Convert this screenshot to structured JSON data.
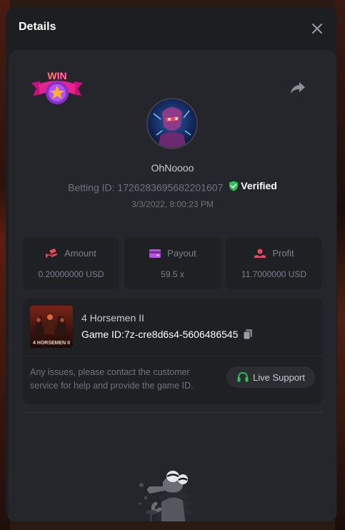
{
  "modal": {
    "title": "Details"
  },
  "bet": {
    "badge": "WIN",
    "username": "OhNoooo",
    "betting_id_label": "Betting ID:",
    "betting_id": "1726283695682201607",
    "verified_label": "Verified",
    "datetime": "3/3/2022, 8:00:23 PM"
  },
  "stats": [
    {
      "label": "Amount",
      "value": "0.20000000 USD",
      "icon": "money-hand-icon",
      "color": "#e74a5c"
    },
    {
      "label": "Payout",
      "value": "59.5 x",
      "icon": "wallet-card-icon",
      "color": "#b552e0"
    },
    {
      "label": "Profit",
      "value": "11.7000000 USD",
      "icon": "profit-hand-icon",
      "color": "#e74a5c"
    }
  ],
  "game": {
    "name": "4 Horsemen II",
    "thumb_text": "4 HORSEMEN II",
    "id_label": "Game ID:",
    "id": "7z-cre8d6s4-5606486545",
    "issue_text": "Any issues, please contact the customer service for help and provide the game ID.",
    "support_label": "Live Support"
  },
  "colors": {
    "accent_green": "#2ec25b",
    "modal_bg": "#1d1e22",
    "card_bg": "#25262b"
  }
}
